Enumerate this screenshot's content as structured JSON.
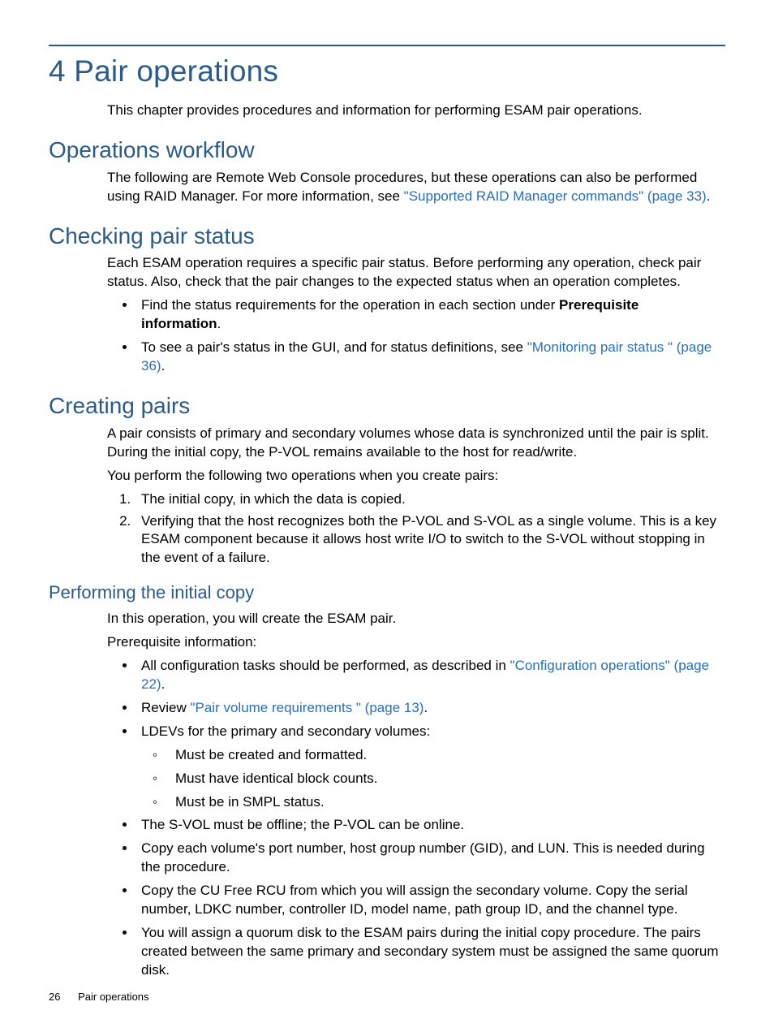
{
  "h1": "4 Pair operations",
  "intro": "This chapter provides procedures and information for performing ESAM pair operations.",
  "sec_workflow": {
    "title": "Operations workflow",
    "p1a": "The following are Remote Web Console procedures, but these operations can also be performed using RAID Manager. For more information, see ",
    "link": "\"Supported RAID Manager commands\" (page 33)",
    "p1b": "."
  },
  "sec_checking": {
    "title": "Checking pair status",
    "p1": "Each ESAM operation requires a specific pair status. Before performing any operation, check pair status. Also, check that the pair changes to the expected status when an operation completes.",
    "b1a": "Find the status requirements for the operation in each section under ",
    "b1bold": "Prerequisite information",
    "b1b": ".",
    "b2a": "To see a pair's status in the GUI, and for status definitions, see ",
    "b2link": "\"Monitoring pair status \" (page 36)",
    "b2b": "."
  },
  "sec_creating": {
    "title": "Creating pairs",
    "p1": "A pair consists of primary and secondary volumes whose data is synchronized until the pair is split. During the initial copy, the P-VOL remains available to the host for read/write.",
    "p2": "You perform the following two operations when you create pairs:",
    "ol1": "The initial copy, in which the data is copied.",
    "ol2": "Verifying that the host recognizes both the P-VOL and S-VOL as a single volume. This is a key ESAM component because it allows host write I/O to switch to the S-VOL without stopping in the event of a failure."
  },
  "sec_perform": {
    "title": "Performing the initial copy",
    "p1": "In this operation, you will create the ESAM pair.",
    "p2": "Prerequisite information:",
    "b1a": "All configuration tasks should be performed, as described in ",
    "b1link": "\"Configuration operations\" (page 22)",
    "b1b": ".",
    "b2a": "Review ",
    "b2link": "\"Pair volume requirements \" (page 13)",
    "b2b": ".",
    "b3": "LDEVs for the primary and secondary volumes:",
    "b3s1": "Must be created and formatted.",
    "b3s2": "Must have identical block counts.",
    "b3s3": "Must be in SMPL status.",
    "b4": "The S-VOL must be offline; the P-VOL can be online.",
    "b5": "Copy each volume's port number, host group number (GID), and LUN. This is needed during the procedure.",
    "b6": "Copy the CU Free RCU from which you will assign the secondary volume. Copy the serial number, LDKC number, controller ID, model name, path group ID, and the channel type.",
    "b7": "You will assign a quorum disk to the ESAM pairs during the initial copy procedure. The pairs created between the same primary and secondary system must be assigned the same quorum disk."
  },
  "footer": {
    "page": "26",
    "label": "Pair operations"
  }
}
